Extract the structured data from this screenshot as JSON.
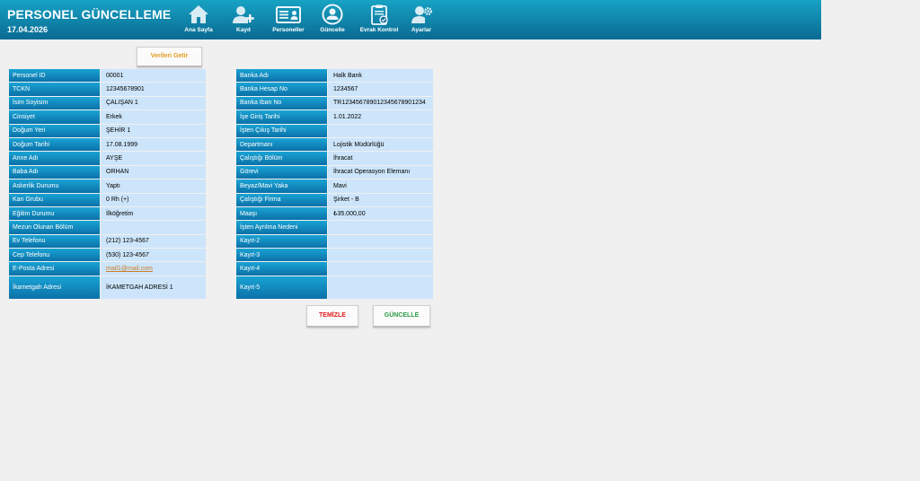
{
  "header": {
    "title": "PERSONEL GÜNCELLEME",
    "date": "17.04.2026",
    "nav": [
      {
        "label": "Ana Sayfa",
        "icon": "home-icon"
      },
      {
        "label": "Kayıt",
        "icon": "add-user-icon"
      },
      {
        "label": "Personeller",
        "icon": "id-card-icon"
      },
      {
        "label": "Güncelle",
        "icon": "update-user-icon"
      },
      {
        "label": "Evrak Kontrol",
        "icon": "clipboard-check-icon"
      },
      {
        "label": "Ayarlar",
        "icon": "user-settings-icon"
      }
    ]
  },
  "buttons": {
    "fetch": "Verileri Getir",
    "clear": "TEMİZLE",
    "update": "GÜNCELLE"
  },
  "colors": {
    "header": "#0a6a92",
    "label_bg": "#0b71a8",
    "value_bg": "#cde5fa",
    "fetch_text": "#e39a1d",
    "clear_text": "#e21b1b",
    "update_text": "#2e9a45"
  },
  "left_fields": [
    {
      "label": "Personel ID",
      "value": "00001"
    },
    {
      "label": "TCKN",
      "value": "12345678901"
    },
    {
      "label": "İsim Soyisim",
      "value": "ÇALIŞAN 1"
    },
    {
      "label": "Cinsiyet",
      "value": "Erkek"
    },
    {
      "label": "Doğum Yeri",
      "value": "ŞEHİR 1"
    },
    {
      "label": "Doğum Tarihi",
      "value": "17.08.1999"
    },
    {
      "label": "Anne Adı",
      "value": "AYŞE"
    },
    {
      "label": "Baba Adı",
      "value": "ORHAN"
    },
    {
      "label": "Askerlik Durumu",
      "value": "Yaptı"
    },
    {
      "label": "Kan Grubu",
      "value": "0 Rh (+)"
    },
    {
      "label": "Eğitim Durumu",
      "value": "İlköğretim"
    },
    {
      "label": "Mezun Olunan Bölüm",
      "value": ""
    },
    {
      "label": "Ev Telefonu",
      "value": "(212) 123-4567"
    },
    {
      "label": "Cep Telefonu",
      "value": "(530) 123-4567"
    },
    {
      "label": "E-Posta Adresi",
      "value": "mail1@mail.com"
    },
    {
      "label": "İkametgah Adresi",
      "value": "İKAMETGAH ADRESİ 1"
    }
  ],
  "right_fields": [
    {
      "label": "Banka Adı",
      "value": "Halk Bank"
    },
    {
      "label": "Banka Hesap No",
      "value": "1234567"
    },
    {
      "label": "Banka Iban No",
      "value": "TR123456789012345678901234"
    },
    {
      "label": "İşe Giriş Tarihi",
      "value": "1.01.2022"
    },
    {
      "label": "İşten Çıkış Tarihi",
      "value": ""
    },
    {
      "label": "Departmanı",
      "value": "Lojistik Müdürlüğü"
    },
    {
      "label": "Çalıştığı Bölüm",
      "value": "İhracat"
    },
    {
      "label": "Görevi",
      "value": "İhracat Operasyon Elemanı"
    },
    {
      "label": "Beyaz/Mavi Yaka",
      "value": "Mavi"
    },
    {
      "label": "Çalıştığı Firma",
      "value": "Şirket - B"
    },
    {
      "label": "Maaşı",
      "value": "₺35.000,00"
    },
    {
      "label": "İşten Ayrılma Nedeni",
      "value": ""
    },
    {
      "label": "Kayıt-2",
      "value": ""
    },
    {
      "label": "Kayıt-3",
      "value": ""
    },
    {
      "label": "Kayıt-4",
      "value": ""
    },
    {
      "label": "Kayıt-5",
      "value": ""
    }
  ]
}
